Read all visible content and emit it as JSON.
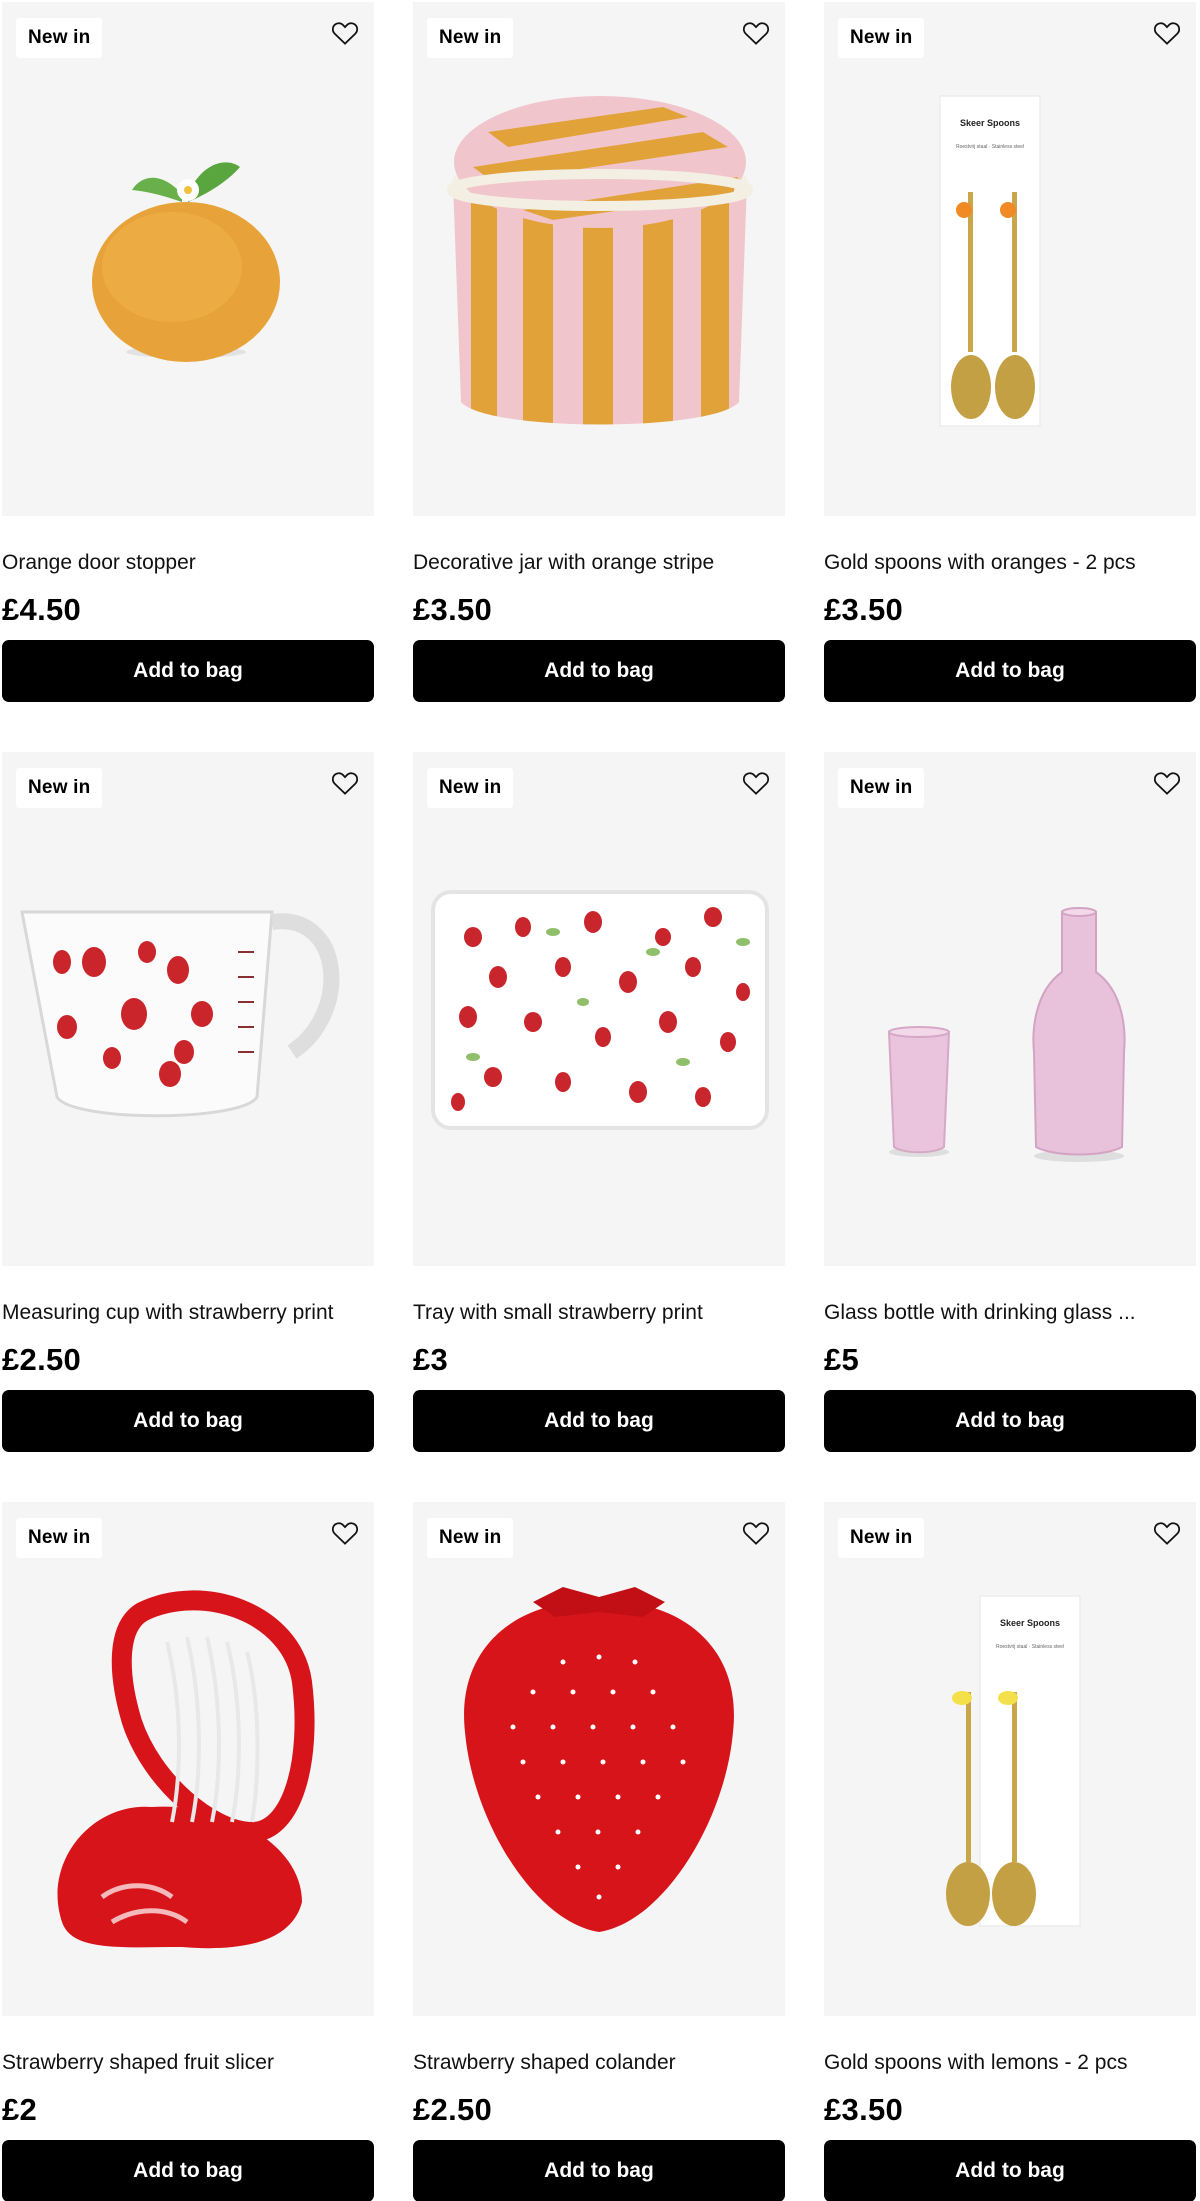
{
  "products": [
    {
      "badge": "New in",
      "title": "Orange door stopper",
      "price": "£4.50",
      "button": "Add to bag"
    },
    {
      "badge": "New in",
      "title": "Decorative jar with orange stripe",
      "price": "£3.50",
      "button": "Add to bag"
    },
    {
      "badge": "New in",
      "title": "Gold spoons with oranges - 2 pcs",
      "price": "£3.50",
      "button": "Add to bag"
    },
    {
      "badge": "New in",
      "title": "Measuring cup with strawberry print",
      "price": "£2.50",
      "button": "Add to bag"
    },
    {
      "badge": "New in",
      "title": "Tray with small strawberry print",
      "price": "£3",
      "button": "Add to bag"
    },
    {
      "badge": "New in",
      "title": "Glass bottle with drinking glass ...",
      "price": "£5",
      "button": "Add to bag"
    },
    {
      "badge": "New in",
      "title": "Strawberry shaped fruit slicer",
      "price": "£2",
      "button": "Add to bag"
    },
    {
      "badge": "New in",
      "title": "Strawberry shaped colander",
      "price": "£2.50",
      "button": "Add to bag"
    },
    {
      "badge": "New in",
      "title": "Gold spoons with lemons - 2 pcs",
      "price": "£3.50",
      "button": "Add to bag"
    }
  ],
  "packaging": {
    "spoons_label_title": "Skeer Spoons",
    "spoons_label_sub": "Roestvrij staal · Stainless steel"
  },
  "icons": {
    "wishlist": "heart-outline-icon"
  },
  "colors": {
    "button_bg": "#000000",
    "button_text": "#ffffff",
    "image_bg": "#f5f5f5",
    "badge_bg": "#ffffff"
  }
}
